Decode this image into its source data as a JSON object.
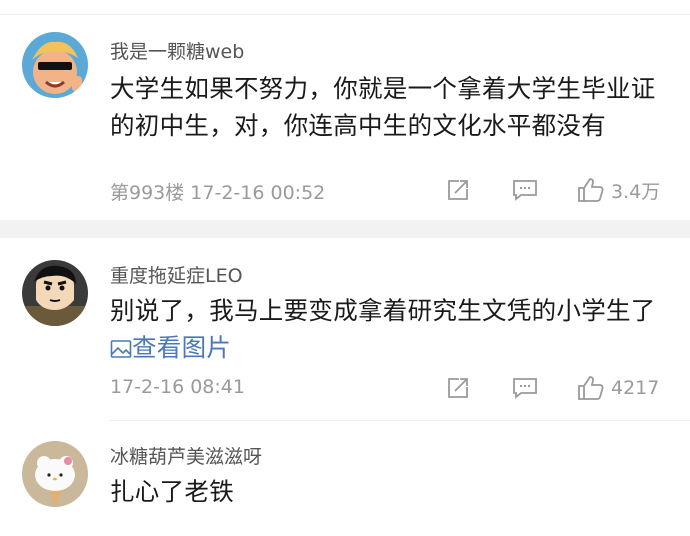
{
  "comments": [
    {
      "username": "我是一颗糖web",
      "text": "大学生如果不努力，你就是一个拿着大学生毕业证的初中生，对，你连高中生的文化水平都没有",
      "meta": "第993楼 17-2-16 00:52",
      "likes": "3.4万",
      "avatar_color": "#5aa9d6"
    },
    {
      "username": "重度拖延症LEO",
      "text": "别说了，我马上要变成拿着研究生文凭的小学生了",
      "link": "查看图片",
      "meta": "17-2-16 08:41",
      "likes": "4217",
      "avatar_color": "#2b2b2b"
    },
    {
      "username": "冰糖葫芦美滋滋呀",
      "text": "扎心了老铁",
      "avatar_color": "#c9b89a"
    }
  ]
}
